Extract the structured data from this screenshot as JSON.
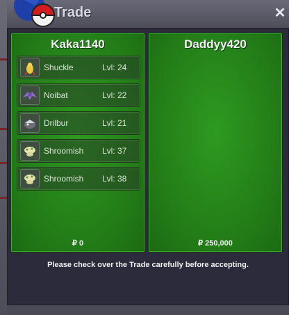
{
  "window": {
    "title": "Trade"
  },
  "left_panel": {
    "player_name": "Kaka1140",
    "pokemon": [
      {
        "name": "Shuckle",
        "level": "Lvl: 24",
        "icon": "shuckle-icon"
      },
      {
        "name": "Noibat",
        "level": "Lvl: 22",
        "icon": "noibat-icon"
      },
      {
        "name": "Drilbur",
        "level": "Lvl: 21",
        "icon": "drilbur-icon"
      },
      {
        "name": "Shroomish",
        "level": "Lvl: 37",
        "icon": "shroomish-icon"
      },
      {
        "name": "Shroomish",
        "level": "Lvl: 38",
        "icon": "shroomish-icon"
      }
    ],
    "money": "₽ 0"
  },
  "right_panel": {
    "player_name": "Daddyy420",
    "pokemon": [],
    "money": "₽ 250,000"
  },
  "notice": "Please check over the Trade carefully before accepting.",
  "colors": {
    "panel_green": "#227a17",
    "window_bg": "#2b2b3c",
    "title_bar": "#5c5c6a"
  }
}
